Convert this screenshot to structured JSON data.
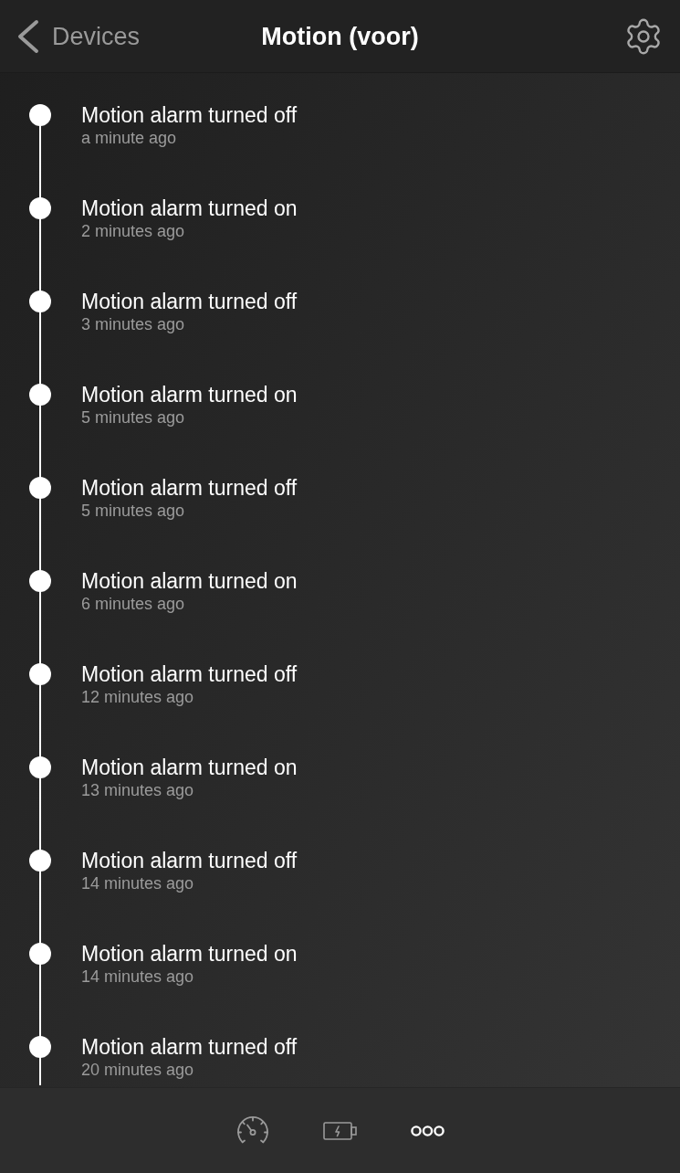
{
  "header": {
    "back_label": "Devices",
    "title": "Motion (voor)"
  },
  "events": [
    {
      "title": "Motion alarm turned off",
      "time": "a minute ago"
    },
    {
      "title": "Motion alarm turned on",
      "time": "2 minutes ago"
    },
    {
      "title": "Motion alarm turned off",
      "time": "3 minutes ago"
    },
    {
      "title": "Motion alarm turned on",
      "time": "5 minutes ago"
    },
    {
      "title": "Motion alarm turned off",
      "time": "5 minutes ago"
    },
    {
      "title": "Motion alarm turned on",
      "time": "6 minutes ago"
    },
    {
      "title": "Motion alarm turned off",
      "time": "12 minutes ago"
    },
    {
      "title": "Motion alarm turned on",
      "time": "13 minutes ago"
    },
    {
      "title": "Motion alarm turned off",
      "time": "14 minutes ago"
    },
    {
      "title": "Motion alarm turned on",
      "time": "14 minutes ago"
    },
    {
      "title": "Motion alarm turned off",
      "time": "20 minutes ago"
    }
  ],
  "footer": {
    "tabs": [
      {
        "kind": "gauge",
        "selected": false
      },
      {
        "kind": "battery",
        "selected": false
      },
      {
        "kind": "more",
        "selected": true
      }
    ]
  }
}
